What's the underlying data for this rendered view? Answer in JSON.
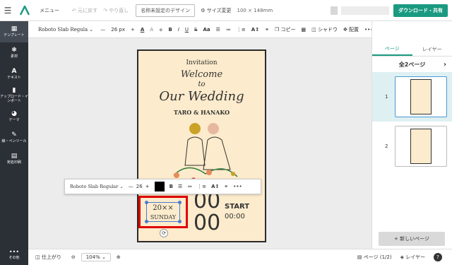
{
  "header": {
    "menu_label": "メニュー",
    "undo_label": "元に戻す",
    "redo_label": "やり直し",
    "doc_name": "名称未設定のデザイン",
    "size_label": "サイズ変更",
    "size_value": "100 × 148mm",
    "download_label": "ダウンロード・共有"
  },
  "sidebar": {
    "items": [
      {
        "label": "テンプレート"
      },
      {
        "label": "素材"
      },
      {
        "label": "テキスト"
      },
      {
        "label": "アップロード・インポート"
      },
      {
        "label": "テーマ"
      },
      {
        "label": "線・ペンツール"
      },
      {
        "label": "宛名印刷"
      }
    ],
    "bottom_label": "その他"
  },
  "toolbar": {
    "font": "Roboto Slab Regula",
    "font_size": "26 px",
    "copy_label": "コピー",
    "shadow_label": "シャドウ",
    "arrange_label": "配置"
  },
  "float_toolbar": {
    "font": "Roboto Slab Regular",
    "size": "26"
  },
  "card": {
    "invitation": "Invitation",
    "welcome": "Welcome",
    "to": "to",
    "our_wedding": "Our Wedding",
    "names": "TARO & HANAKO",
    "big_top": "00",
    "big_bottom": "00",
    "start_label": "START",
    "start_time": "00:00",
    "date_text": "20××",
    "day_text": "SUNDAY"
  },
  "right_panel": {
    "tab_page": "ページ",
    "tab_layer": "レイヤー",
    "header": "全2ページ",
    "pages": [
      {
        "num": "1"
      },
      {
        "num": "2"
      }
    ],
    "new_page_label": "+ 新しいページ"
  },
  "bottombar": {
    "finish_label": "仕上がり",
    "zoom": "104%",
    "page_label": "ページ",
    "page_count": "(1/2)",
    "layer_label": "レイヤー",
    "help": "?"
  },
  "colors": {
    "accent": "#1a9a80",
    "sidebar": "#2b2f36",
    "card_bg": "#fcebcc",
    "highlight": "#e00000"
  }
}
